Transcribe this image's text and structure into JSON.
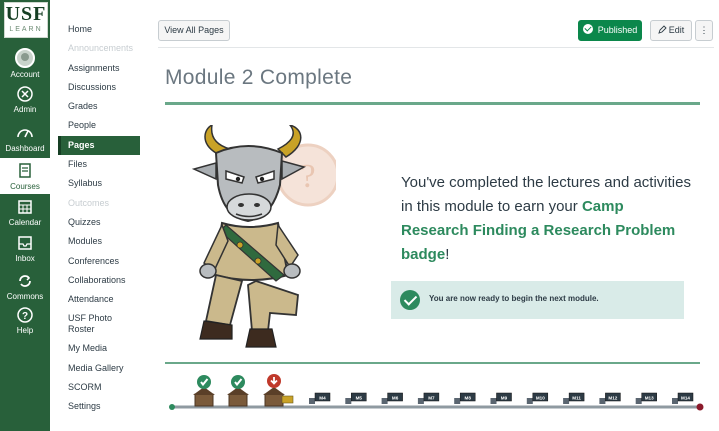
{
  "global_nav": {
    "logo_line1": "USF",
    "logo_line2": "LEARN",
    "items": [
      {
        "label": "Account",
        "icon": "account-avatar-icon"
      },
      {
        "label": "Admin",
        "icon": "admin-shield-icon"
      },
      {
        "label": "Dashboard",
        "icon": "dashboard-gauge-icon"
      },
      {
        "label": "Courses",
        "icon": "courses-book-icon",
        "active": true
      },
      {
        "label": "Calendar",
        "icon": "calendar-icon"
      },
      {
        "label": "Inbox",
        "icon": "inbox-icon"
      },
      {
        "label": "Commons",
        "icon": "commons-icon"
      },
      {
        "label": "Help",
        "icon": "help-icon"
      }
    ]
  },
  "course_nav": {
    "items": [
      {
        "label": "Home"
      },
      {
        "label": "Announcements",
        "disabled": true
      },
      {
        "label": "Assignments"
      },
      {
        "label": "Discussions"
      },
      {
        "label": "Grades"
      },
      {
        "label": "People"
      },
      {
        "label": "Pages",
        "active": true
      },
      {
        "label": "Files"
      },
      {
        "label": "Syllabus"
      },
      {
        "label": "Outcomes",
        "disabled": true
      },
      {
        "label": "Quizzes"
      },
      {
        "label": "Modules"
      },
      {
        "label": "Conferences"
      },
      {
        "label": "Collaborations"
      },
      {
        "label": "Attendance"
      },
      {
        "label": "USF Photo Roster"
      },
      {
        "label": "My Media"
      },
      {
        "label": "Media Gallery"
      },
      {
        "label": "SCORM"
      },
      {
        "label": "Settings"
      }
    ]
  },
  "header": {
    "view_all_label": "View All Pages",
    "published_label": "Published",
    "edit_label": "Edit",
    "more_label": "⋮"
  },
  "page": {
    "title": "Module 2 Complete",
    "message_text": "You've completed the lectures and activities in this module to earn your",
    "badge_text": "Camp Research Finding a Research Problem badge",
    "message_end": "!",
    "notice_text": "You are now ready to begin the next module."
  },
  "progress_track": {
    "completed_modules": 2,
    "current_module": 3,
    "module_labels": [
      "M4",
      "M5",
      "M6",
      "M7",
      "M8",
      "M9",
      "M10",
      "M11",
      "M12",
      "M13",
      "M14"
    ],
    "colors": {
      "green": "#2d8a5e",
      "red": "#c0392b",
      "track": "#8f9aa1"
    }
  },
  "colors": {
    "nav_green": "#28603a",
    "accent_green": "#6aa88a",
    "published": "#0b874b",
    "notice_bg": "#d9ebe8"
  }
}
